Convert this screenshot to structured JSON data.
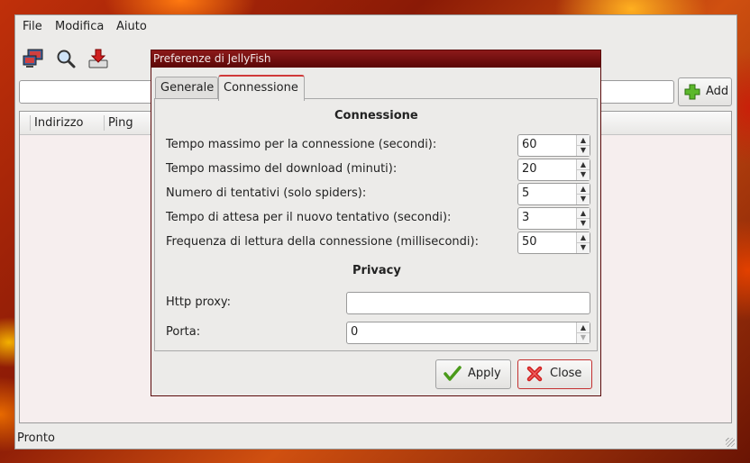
{
  "menu": {
    "file": "File",
    "edit": "Modifica",
    "help": "Aiuto"
  },
  "toolbar": {
    "connect_icon": "network-icon",
    "search_icon": "search-icon",
    "download_icon": "download-icon"
  },
  "main": {
    "add_label": "Add",
    "columns": [
      "Indirizzo",
      "Ping"
    ],
    "status": "Pronto"
  },
  "dialog": {
    "title": "Preferenze di JellyFish",
    "tabs": [
      "Generale",
      "Connessione"
    ],
    "active_tab": "Connessione",
    "connection_heading": "Connessione",
    "fields": [
      {
        "label": "Tempo massimo per la connessione (secondi):",
        "value": "60"
      },
      {
        "label": "Tempo massimo del download (minuti):",
        "value": "20"
      },
      {
        "label": "Numero di tentativi (solo spiders):",
        "value": "5"
      },
      {
        "label": "Tempo di attesa per il nuovo tentativo (secondi):",
        "value": "3"
      },
      {
        "label": "Frequenza di lettura della connessione (millisecondi):",
        "value": "50"
      }
    ],
    "privacy_heading": "Privacy",
    "proxy_label": "Http proxy:",
    "proxy_value": "",
    "port_label": "Porta:",
    "port_value": "0",
    "apply_label": "Apply",
    "close_label": "Close"
  },
  "colors": {
    "title_bar": "#7a1010",
    "active_tab_accent": "#d03a3a",
    "close_border": "#c43030"
  }
}
